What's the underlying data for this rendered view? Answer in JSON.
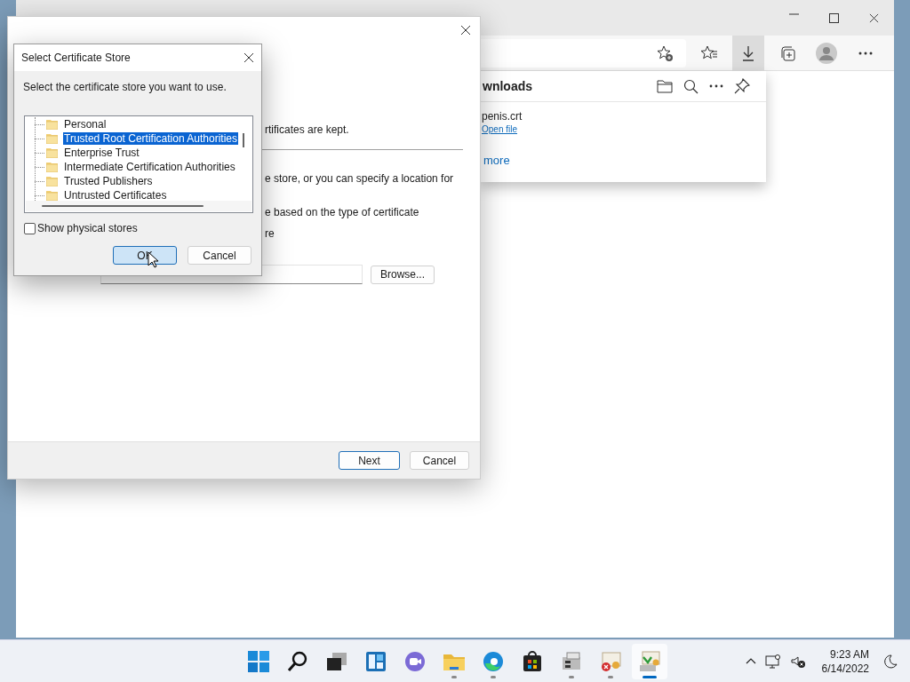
{
  "browser": {
    "toolbar_buttons": [
      {
        "kind": "add-favorite",
        "selected": false
      },
      {
        "kind": "favorites",
        "selected": false
      },
      {
        "kind": "download",
        "selected": true
      },
      {
        "kind": "collections",
        "selected": false
      },
      {
        "kind": "profile",
        "selected": false
      },
      {
        "kind": "more",
        "selected": false
      }
    ]
  },
  "downloads_panel": {
    "title": "wnloads",
    "items": [
      {
        "file": "penis.crt",
        "action": "Open file"
      }
    ],
    "more_link": "more"
  },
  "wizard": {
    "lines": [
      "rtificates are kept.",
      "e store, or you can specify a location for",
      "e based on the type of certificate",
      "re"
    ],
    "browse_button": "Browse...",
    "buttons": [
      {
        "label": "Next",
        "default": true
      },
      {
        "label": "Cancel",
        "default": false
      }
    ]
  },
  "dialog": {
    "title": "Select Certificate Store",
    "prompt": "Select the certificate store you want to use.",
    "stores": [
      {
        "label": "Personal",
        "selected": false
      },
      {
        "label": "Trusted Root Certification Authorities",
        "selected": true
      },
      {
        "label": "Enterprise Trust",
        "selected": false
      },
      {
        "label": "Intermediate Certification Authorities",
        "selected": false
      },
      {
        "label": "Trusted Publishers",
        "selected": false
      },
      {
        "label": "Untrusted Certificates",
        "selected": false
      }
    ],
    "show_physical_stores": {
      "label": "Show physical stores",
      "checked": false
    },
    "buttons": [
      {
        "label": "OK",
        "default": true
      },
      {
        "label": "Cancel",
        "default": false
      }
    ]
  },
  "taskbar": {
    "apps": [
      {
        "kind": "start",
        "running": false,
        "selected": false
      },
      {
        "kind": "search",
        "running": false,
        "selected": false
      },
      {
        "kind": "task-view",
        "running": false,
        "selected": false
      },
      {
        "kind": "widgets",
        "running": false,
        "selected": false
      },
      {
        "kind": "chat",
        "running": false,
        "selected": false
      },
      {
        "kind": "explorer",
        "running": true,
        "selected": false
      },
      {
        "kind": "edge",
        "running": true,
        "selected": false
      },
      {
        "kind": "store",
        "running": false,
        "selected": false
      },
      {
        "kind": "drive",
        "running": true,
        "selected": false
      },
      {
        "kind": "cert-error",
        "running": true,
        "selected": false
      },
      {
        "kind": "cert-import",
        "running": true,
        "selected": true
      }
    ],
    "clock": {
      "time": "9:23 AM",
      "date": "6/14/2022"
    }
  }
}
